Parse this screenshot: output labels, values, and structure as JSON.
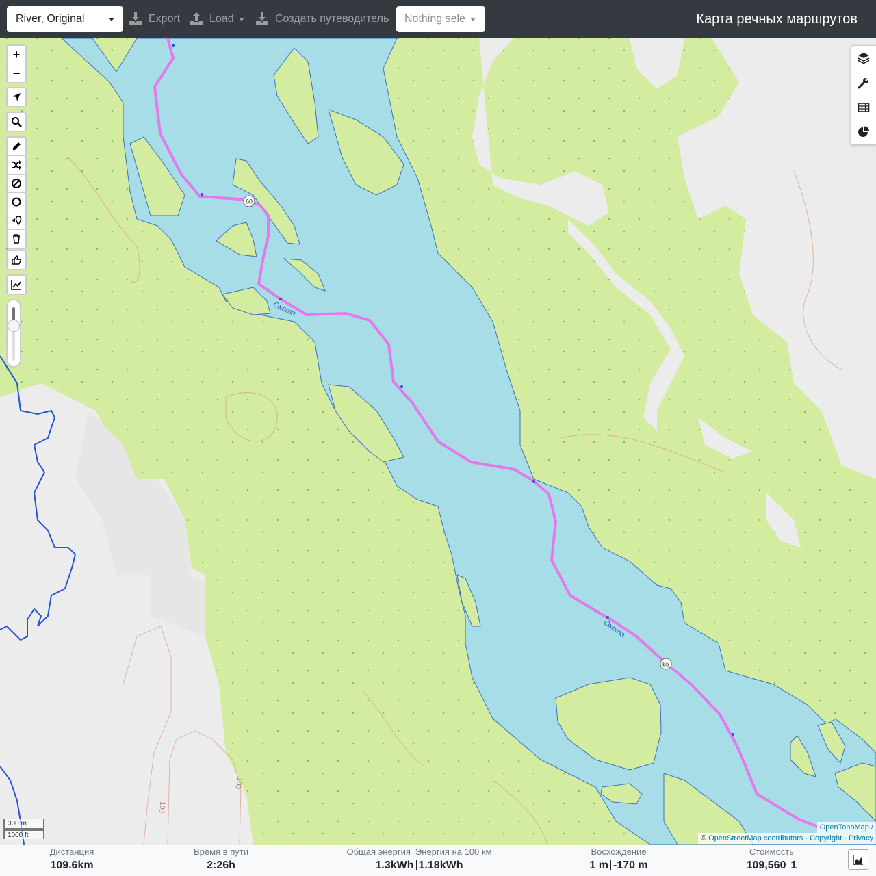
{
  "navbar": {
    "profile_select": "River, Original",
    "export_label": "Export",
    "load_label": "Load",
    "guide_label": "Создать путеводитель",
    "route_select_placeholder": "Nothing sele",
    "app_title": "Карта речных маршрутов"
  },
  "map": {
    "river_name": "Охота",
    "waypoints": [
      "60",
      "65"
    ],
    "contour_labels": [
      "100",
      "100"
    ],
    "colors": {
      "land": "#d3ec9f",
      "forest_clearing": "#ececec",
      "water": "#a6dde7",
      "route": "#e479ec",
      "stream": "#2455d8",
      "contour": "#d9a080"
    },
    "scale": {
      "metric": "300 m",
      "imperial": "1000 ft"
    },
    "zoom_slider_value": 0.3
  },
  "controls": {
    "zoom_in": "+",
    "zoom_out": "−"
  },
  "sidebar_tabs": [
    "layers-icon",
    "wrench-icon",
    "table-icon",
    "pie-chart-icon"
  ],
  "attribution": {
    "line1": "OpenTopoMap /",
    "prefix": "© ",
    "osm": "OpenStreetMap contributors",
    "dot1": " · ",
    "copyright": "Copyright",
    "dot2": " · ",
    "privacy": "Privacy"
  },
  "stats": {
    "distance": {
      "title": "Дистанция",
      "value": "109.6",
      "unit": "km"
    },
    "time": {
      "title": "Время в пути",
      "value": "2:26",
      "unit": "h"
    },
    "energy": {
      "title_total": "Общая энергия",
      "title_per100": "Энергия на 100 км",
      "total_value": "1.3",
      "total_unit": "kWh",
      "per100_value": "1.18",
      "per100_unit": "kWh"
    },
    "ascent": {
      "title": "Восхождение",
      "up_value": "1",
      "up_unit": "m",
      "down_value": "-170",
      "down_unit": "m"
    },
    "cost": {
      "title": "Стоимость",
      "value": "109,560",
      "count": "1"
    }
  }
}
